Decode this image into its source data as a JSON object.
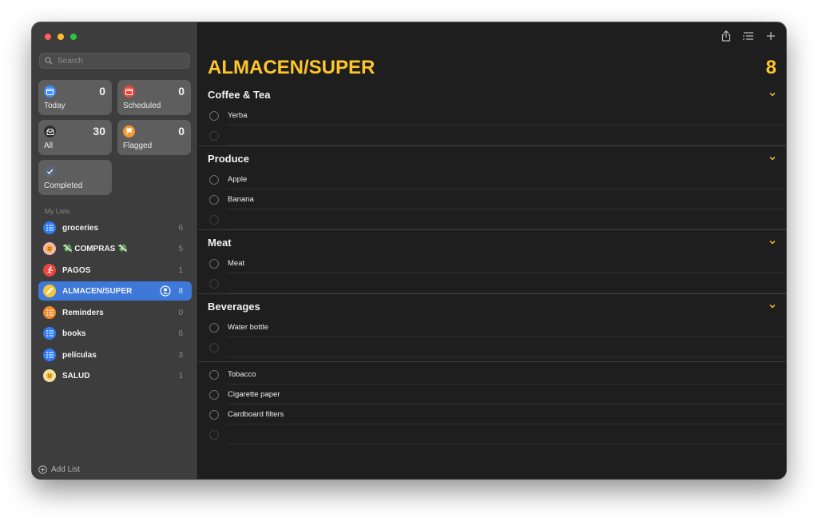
{
  "sidebar": {
    "search_placeholder": "Search",
    "smart_lists": [
      {
        "label": "Today",
        "count": "0",
        "icon": "calendar-today-icon",
        "color": "#3f8ef5"
      },
      {
        "label": "Scheduled",
        "count": "0",
        "icon": "calendar-scheduled-icon",
        "color": "#e8483c"
      },
      {
        "label": "All",
        "count": "30",
        "icon": "tray-icon",
        "color": "#3a3a3a"
      },
      {
        "label": "Flagged",
        "count": "0",
        "icon": "flag-icon",
        "color": "#f29a30"
      },
      {
        "label": "Completed",
        "icon": "checkmark-icon",
        "color": "#5a6478"
      }
    ],
    "section_title": "My Lists",
    "lists": [
      {
        "name": "groceries",
        "count": "6",
        "icon": "list-bullet-icon",
        "color": "#2f7cf6"
      },
      {
        "name": "💸 COMPRAS 💸",
        "count": "5",
        "icon": "face-emoji-icon",
        "color": "#f2b8b0"
      },
      {
        "name": "PAGOS",
        "count": "1",
        "icon": "running-figure-icon",
        "color": "#e8483c"
      },
      {
        "name": "ALMACEN/SUPER",
        "count": "8",
        "icon": "baguette-icon",
        "color": "#f5c53a"
      },
      {
        "name": "Reminders",
        "count": "0",
        "icon": "list-bullet-icon",
        "color": "#f08a2a"
      },
      {
        "name": "books",
        "count": "6",
        "icon": "list-bullet-icon",
        "color": "#2f7cf6"
      },
      {
        "name": "películas",
        "count": "3",
        "icon": "list-bullet-icon",
        "color": "#2f7cf6"
      },
      {
        "name": "SALUD",
        "count": "1",
        "icon": "smiley-face-icon",
        "color": "#f0e3a0"
      }
    ],
    "add_list_label": "Add List"
  },
  "main": {
    "title": "ALMACEN/SUPER",
    "count": "8",
    "accent": "#ffc62a",
    "groups": [
      {
        "name": "Coffee & Tea",
        "tasks": [
          "Yerba"
        ]
      },
      {
        "name": "Produce",
        "tasks": [
          "Apple",
          "Banana"
        ]
      },
      {
        "name": "Meat",
        "tasks": [
          "Meat"
        ]
      },
      {
        "name": "Beverages",
        "tasks": [
          "Water bottle"
        ]
      }
    ],
    "ungrouped_tasks": [
      "Tobacco",
      "Cigarette paper",
      "Cardboard filters"
    ]
  }
}
